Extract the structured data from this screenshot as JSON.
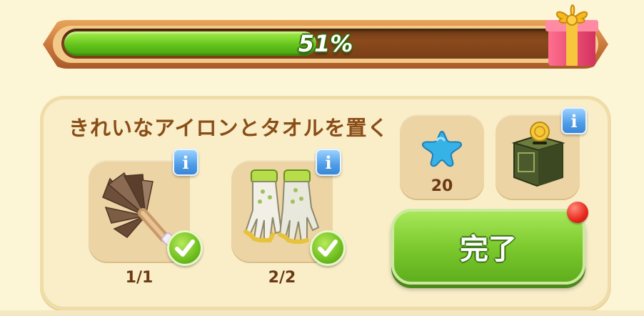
{
  "progress": {
    "percent_text": "51%",
    "value": 0.51
  },
  "quest": {
    "title": "きれいなアイロンとタオルを置く",
    "requirements": [
      {
        "icon": "feather-duster-icon",
        "count": "1/1",
        "completed": true
      },
      {
        "icon": "garden-gloves-icon",
        "count": "2/2",
        "completed": true
      }
    ],
    "rewards": [
      {
        "icon": "blue-star-icon",
        "amount": "20"
      },
      {
        "icon": "coin-safe-box-icon",
        "amount": ""
      }
    ],
    "complete_button_label": "完了"
  },
  "colors": {
    "accent_green": "#7cca2e",
    "title_brown": "#8a4d17",
    "info_blue": "#4f9de8",
    "notify_red": "#e7281c"
  }
}
